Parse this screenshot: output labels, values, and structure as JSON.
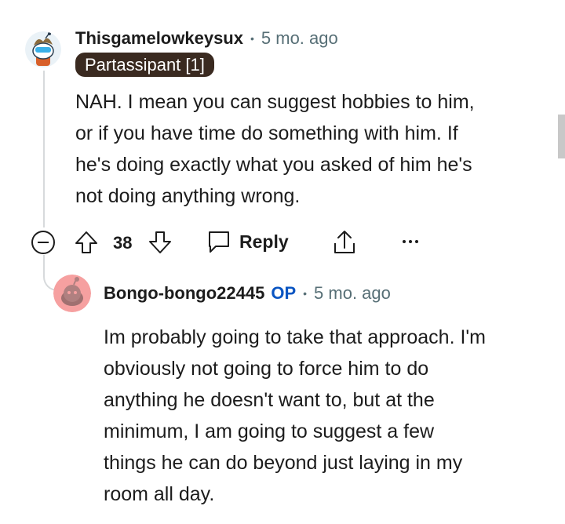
{
  "comment": {
    "username": "Thisgamelowkeysux",
    "time": "5 mo. ago",
    "flair": "Partassipant [1]",
    "body_lines": [
      "NAH. I mean you can suggest hobbies to him,",
      "or if you have time do something with him. If",
      "he's doing exactly what you asked of him he's",
      "not doing anything wrong."
    ],
    "votes": "38",
    "reply_label": "Reply"
  },
  "reply": {
    "username": "Bongo-bongo22445",
    "op_badge": "OP",
    "time": "5 mo. ago",
    "body_lines": [
      "Im probably going to take that approach. I'm",
      "obviously not going to force him to do",
      "anything he doesn't want to, but at the",
      "minimum, I am going to suggest a few",
      "things he can do beyond just laying in my",
      "room all day."
    ]
  },
  "colors": {
    "op_badge": "#0a55c2",
    "flair_background": "#3a2a20",
    "meta_gray": "#576f76",
    "thread_line": "#d7dadc",
    "reply_avatar": "#f6a0a0"
  },
  "icons": {
    "dot_separator": "•",
    "collapse": "collapse-minus-icon",
    "upvote": "arrow-up-icon",
    "downvote": "arrow-down-icon",
    "reply": "speech-bubble-icon",
    "share": "share-icon",
    "more": "more-dots-icon"
  }
}
